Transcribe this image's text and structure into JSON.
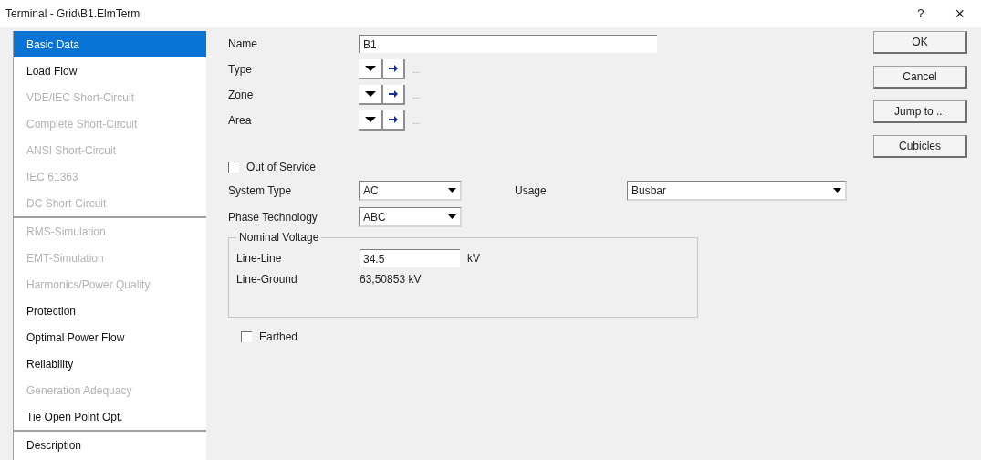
{
  "window": {
    "title": "Terminal - Grid\\B1.ElmTerm",
    "help": "?",
    "close": "×"
  },
  "sidebar": {
    "groups": [
      {
        "items": [
          {
            "label": "Basic Data",
            "selected": true,
            "disabled": false
          },
          {
            "label": "Load Flow",
            "selected": false,
            "disabled": false
          },
          {
            "label": "VDE/IEC Short-Circuit",
            "selected": false,
            "disabled": true
          },
          {
            "label": "Complete Short-Circuit",
            "selected": false,
            "disabled": true
          },
          {
            "label": "ANSI Short-Circuit",
            "selected": false,
            "disabled": true
          },
          {
            "label": "IEC 61363",
            "selected": false,
            "disabled": true
          },
          {
            "label": "DC Short-Circuit",
            "selected": false,
            "disabled": true
          }
        ]
      },
      {
        "items": [
          {
            "label": "RMS-Simulation",
            "selected": false,
            "disabled": true
          },
          {
            "label": "EMT-Simulation",
            "selected": false,
            "disabled": true
          },
          {
            "label": "Harmonics/Power Quality",
            "selected": false,
            "disabled": true
          },
          {
            "label": "Protection",
            "selected": false,
            "disabled": false
          },
          {
            "label": "Optimal Power Flow",
            "selected": false,
            "disabled": false
          },
          {
            "label": "Reliability",
            "selected": false,
            "disabled": false
          },
          {
            "label": "Generation Adequacy",
            "selected": false,
            "disabled": true
          },
          {
            "label": "Tie Open Point Opt.",
            "selected": false,
            "disabled": false
          }
        ]
      },
      {
        "items": [
          {
            "label": "Description",
            "selected": false,
            "disabled": false
          }
        ]
      }
    ]
  },
  "name": {
    "label": "Name",
    "value": "B1"
  },
  "references": [
    {
      "label": "Type",
      "value": "..."
    },
    {
      "label": "Zone",
      "value": "..."
    },
    {
      "label": "Area",
      "value": "..."
    }
  ],
  "out_of_service": {
    "label": "Out of Service",
    "checked": false
  },
  "system_type": {
    "label": "System Type",
    "value": "AC"
  },
  "usage": {
    "label": "Usage",
    "value": "Busbar"
  },
  "phase_technology": {
    "label": "Phase Technology",
    "value": "ABC"
  },
  "nominal_voltage": {
    "title": "Nominal Voltage",
    "line_line": {
      "label": "Line-Line",
      "value": "34.5",
      "unit": "kV"
    },
    "line_ground": {
      "label": "Line-Ground",
      "value": "63,50853 kV"
    }
  },
  "earthed": {
    "label": "Earthed",
    "checked": false
  },
  "buttons": [
    "OK",
    "Cancel",
    "Jump to ...",
    "Cubicles"
  ]
}
